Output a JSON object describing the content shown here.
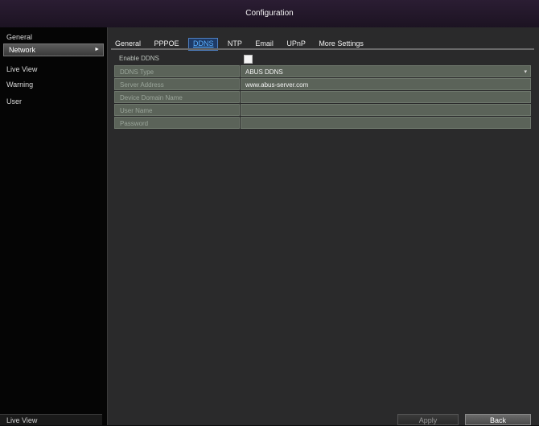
{
  "window": {
    "title": "Configuration"
  },
  "sidebar": {
    "items": [
      {
        "label": "General"
      },
      {
        "label": "Network",
        "arrow": "►"
      },
      {
        "label": "Live View"
      },
      {
        "label": "Warning"
      },
      {
        "label": "User"
      }
    ],
    "bottom_label": "Live View"
  },
  "tabs": [
    "General",
    "PPPOE",
    "DDNS",
    "NTP",
    "Email",
    "UPnP",
    "More Settings"
  ],
  "form": {
    "enable_ddns_label": "Enable DDNS",
    "enable_ddns_checked": true,
    "ddns_type_label": "DDNS Type",
    "ddns_type_value": "ABUS DDNS",
    "ddns_type_chevron": "▾",
    "server_address_label": "Server Address",
    "server_address_value": "www.abus-server.com",
    "device_domain_label": "Device Domain Name",
    "device_domain_value": "",
    "user_name_label": "User Name",
    "user_name_value": "",
    "password_label": "Password",
    "password_value": ""
  },
  "buttons": {
    "apply": "Apply",
    "back": "Back"
  }
}
